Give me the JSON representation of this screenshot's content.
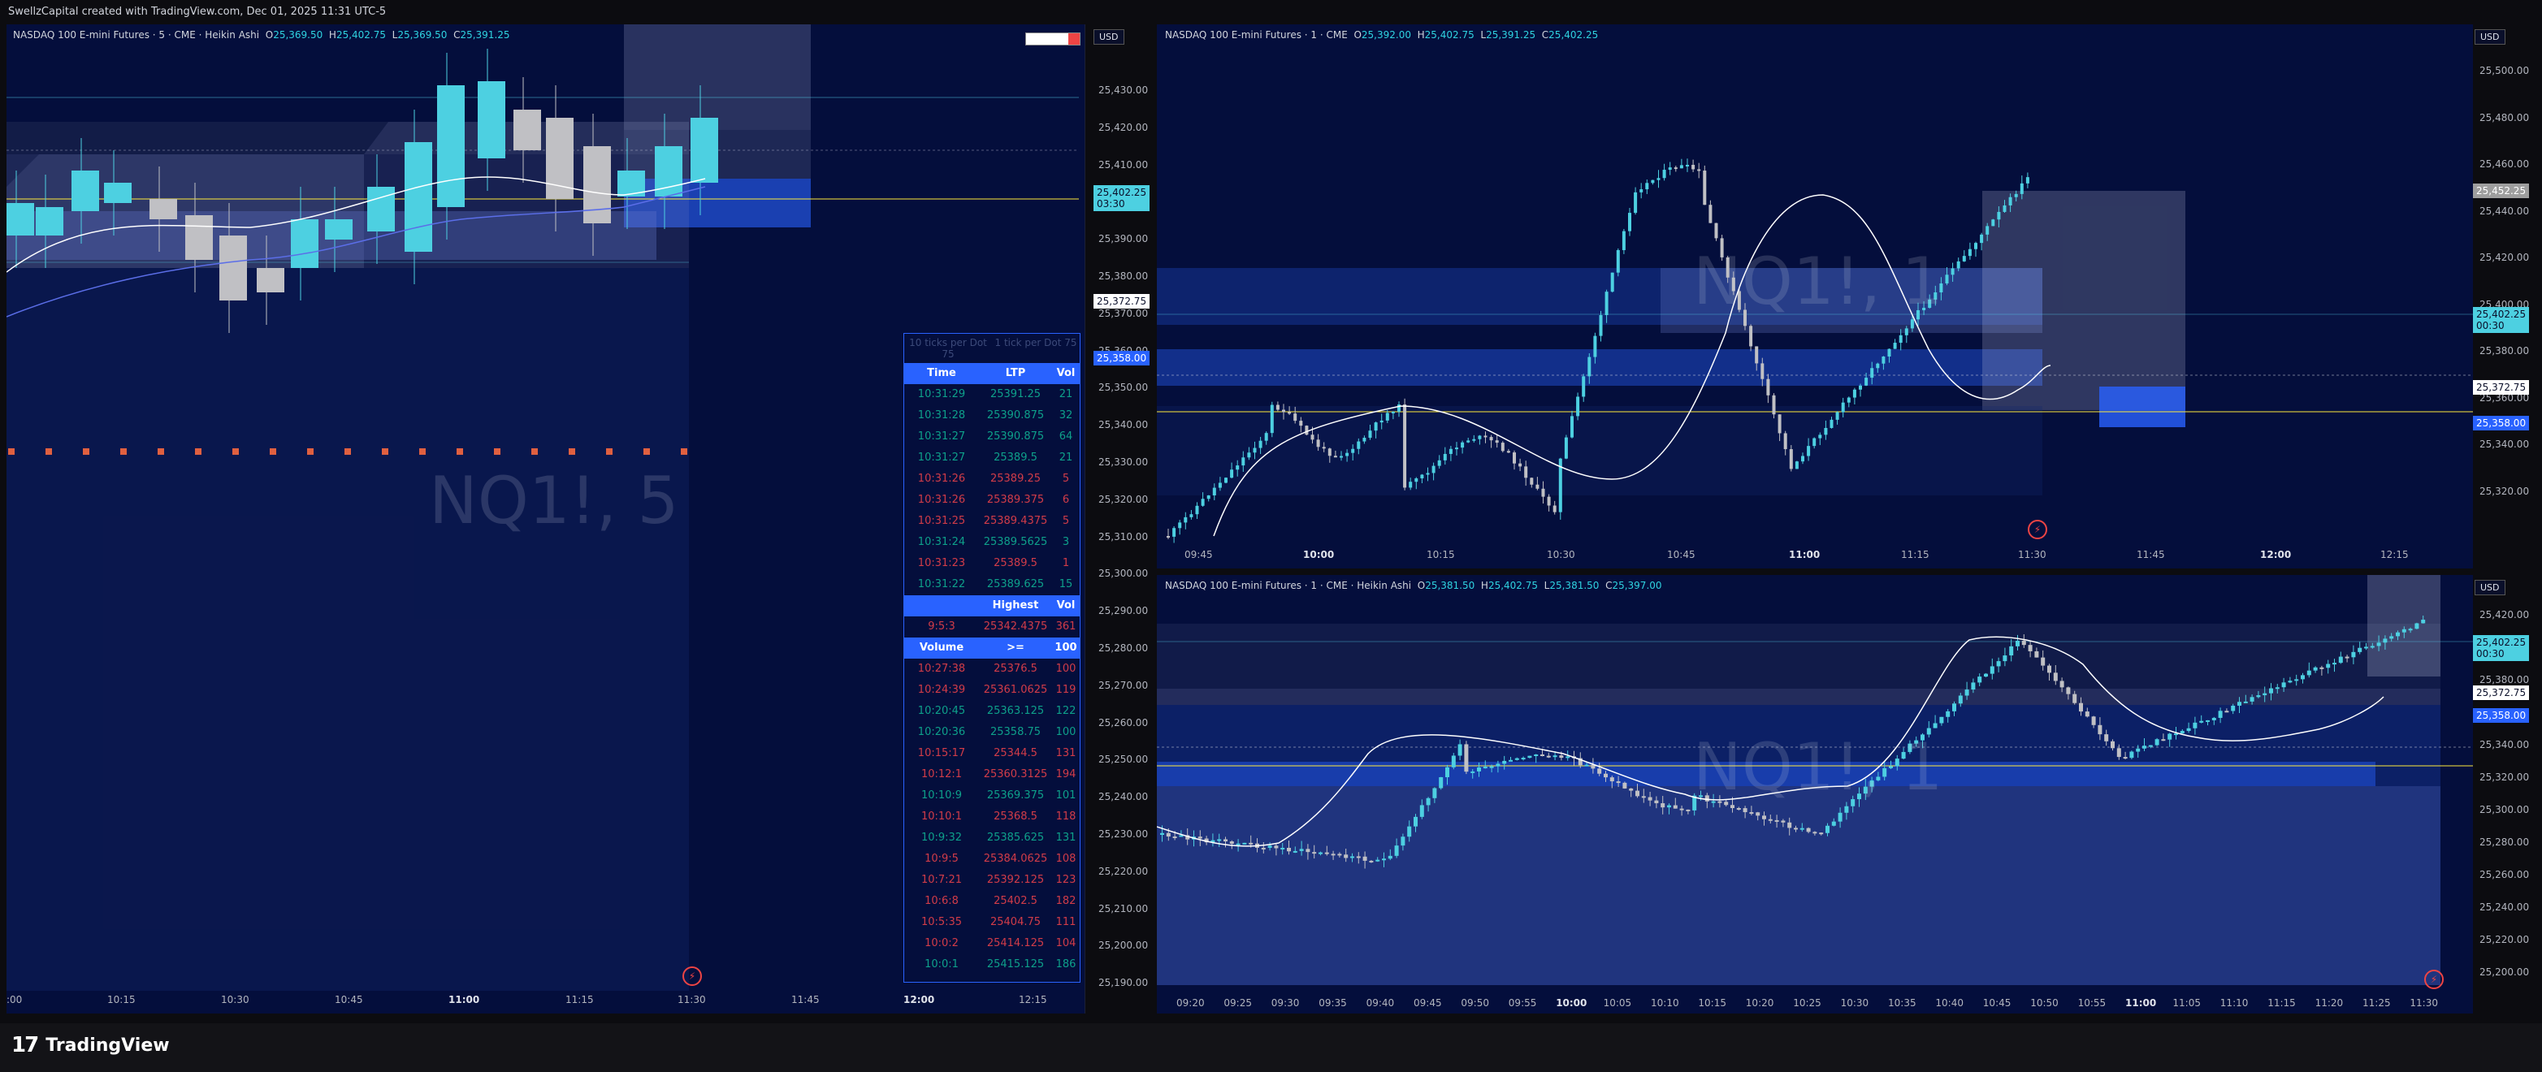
{
  "title_bar": "SwellzCapital created with TradingView.com, Dec 01, 2025 11:31 UTC-5",
  "brand": {
    "mark": "17",
    "name": "TradingView"
  },
  "left_pane": {
    "legend": {
      "name": "NASDAQ 100 E-mini Futures · 5 · CME · Heikin Ashi",
      "o_label": "O",
      "o": "25,369.50",
      "h_label": "H",
      "h": "25,402.75",
      "l_label": "L",
      "l": "25,369.50",
      "c_label": "C",
      "c": "25,391.25"
    },
    "watermark": "NQ1!, 5",
    "currency": "USD",
    "y_ticks": [
      "25,430.00",
      "25,420.00",
      "25,410.00",
      "25,400.00",
      "25,390.00",
      "25,380.00",
      "25,370.00",
      "25,360.00",
      "25,350.00",
      "25,340.00",
      "25,330.00",
      "25,320.00",
      "25,310.00",
      "25,300.00",
      "25,290.00",
      "25,280.00",
      "25,270.00",
      "25,260.00",
      "25,250.00",
      "25,240.00",
      "25,230.00",
      "25,220.00",
      "25,210.00",
      "25,200.00",
      "25,190.00"
    ],
    "price_tags": [
      {
        "text": "25,402.25",
        "sub": "03:30"
      },
      {
        "text": "25,372.75"
      },
      {
        "text": "25,358.00"
      }
    ],
    "x_ticks": [
      {
        "label": ":00",
        "bold": false
      },
      {
        "label": "10:15",
        "bold": false
      },
      {
        "label": "10:30",
        "bold": false
      },
      {
        "label": "10:45",
        "bold": false
      },
      {
        "label": "11:00",
        "bold": true
      },
      {
        "label": "11:15",
        "bold": false
      },
      {
        "label": "11:30",
        "bold": false
      },
      {
        "label": "11:45",
        "bold": false
      },
      {
        "label": "12:00",
        "bold": true
      },
      {
        "label": "12:15",
        "bold": false
      }
    ]
  },
  "tape": {
    "group_headers": [
      "10 ticks per Dot 75",
      "1 tick per Dot 75"
    ],
    "trades_header": [
      "Time",
      "LTP",
      "Vol"
    ],
    "trades": [
      {
        "time": "10:31:29",
        "ltp": "25391.25",
        "vol": "21",
        "side": "g"
      },
      {
        "time": "10:31:28",
        "ltp": "25390.875",
        "vol": "32",
        "side": "g"
      },
      {
        "time": "10:31:27",
        "ltp": "25390.875",
        "vol": "64",
        "side": "g"
      },
      {
        "time": "10:31:27",
        "ltp": "25389.5",
        "vol": "21",
        "side": "g"
      },
      {
        "time": "10:31:26",
        "ltp": "25389.25",
        "vol": "5",
        "side": "r"
      },
      {
        "time": "10:31:26",
        "ltp": "25389.375",
        "vol": "6",
        "side": "r"
      },
      {
        "time": "10:31:25",
        "ltp": "25389.4375",
        "vol": "5",
        "side": "r"
      },
      {
        "time": "10:31:24",
        "ltp": "25389.5625",
        "vol": "3",
        "side": "g"
      },
      {
        "time": "10:31:23",
        "ltp": "25389.5",
        "vol": "1",
        "side": "r"
      },
      {
        "time": "10:31:22",
        "ltp": "25389.625",
        "vol": "15",
        "side": "g"
      }
    ],
    "highest_header": [
      "",
      "Highest",
      "Vol"
    ],
    "highest_row": {
      "time": "9:5:3",
      "ltp": "25342.4375",
      "vol": "361",
      "side": "r"
    },
    "volume_header": [
      "Volume",
      ">=",
      "100"
    ],
    "big_trades": [
      {
        "time": "10:27:38",
        "ltp": "25376.5",
        "vol": "100",
        "side": "r"
      },
      {
        "time": "10:24:39",
        "ltp": "25361.0625",
        "vol": "119",
        "side": "r"
      },
      {
        "time": "10:20:45",
        "ltp": "25363.125",
        "vol": "122",
        "side": "g"
      },
      {
        "time": "10:20:36",
        "ltp": "25358.75",
        "vol": "100",
        "side": "g"
      },
      {
        "time": "10:15:17",
        "ltp": "25344.5",
        "vol": "131",
        "side": "r"
      },
      {
        "time": "10:12:1",
        "ltp": "25360.3125",
        "vol": "194",
        "side": "r"
      },
      {
        "time": "10:10:9",
        "ltp": "25369.375",
        "vol": "101",
        "side": "g"
      },
      {
        "time": "10:10:1",
        "ltp": "25368.5",
        "vol": "118",
        "side": "r"
      },
      {
        "time": "10:9:32",
        "ltp": "25385.625",
        "vol": "131",
        "side": "g"
      },
      {
        "time": "10:9:5",
        "ltp": "25384.0625",
        "vol": "108",
        "side": "r"
      },
      {
        "time": "10:7:21",
        "ltp": "25392.125",
        "vol": "123",
        "side": "r"
      },
      {
        "time": "10:6:8",
        "ltp": "25402.5",
        "vol": "182",
        "side": "r"
      },
      {
        "time": "10:5:35",
        "ltp": "25404.75",
        "vol": "111",
        "side": "r"
      },
      {
        "time": "10:0:2",
        "ltp": "25414.125",
        "vol": "104",
        "side": "r"
      },
      {
        "time": "10:0:1",
        "ltp": "25415.125",
        "vol": "186",
        "side": "g"
      }
    ]
  },
  "top_right_pane": {
    "legend": {
      "name": "NASDAQ 100 E-mini Futures · 1 · CME",
      "o_label": "O",
      "o": "25,392.00",
      "h_label": "H",
      "h": "25,402.75",
      "l_label": "L",
      "l": "25,391.25",
      "c_label": "C",
      "c": "25,402.25"
    },
    "watermark": "NQ1!, 1",
    "currency": "USD",
    "y_ticks": [
      "25,500.00",
      "25,480.00",
      "25,460.00",
      "25,440.00",
      "25,420.00",
      "25,400.00",
      "25,380.00",
      "25,360.00",
      "25,340.00",
      "25,320.00"
    ],
    "price_tags": [
      {
        "text": "25,452.25"
      },
      {
        "text": "25,402.25",
        "sub": "00:30"
      },
      {
        "text": "25,372.75"
      },
      {
        "text": "25,358.00"
      }
    ],
    "x_ticks": [
      {
        "label": "09:45",
        "bold": false
      },
      {
        "label": "10:00",
        "bold": true
      },
      {
        "label": "10:15",
        "bold": false
      },
      {
        "label": "10:30",
        "bold": false
      },
      {
        "label": "10:45",
        "bold": false
      },
      {
        "label": "11:00",
        "bold": true
      },
      {
        "label": "11:15",
        "bold": false
      },
      {
        "label": "11:30",
        "bold": false
      },
      {
        "label": "11:45",
        "bold": false
      },
      {
        "label": "12:00",
        "bold": true
      },
      {
        "label": "12:15",
        "bold": false
      }
    ]
  },
  "bottom_right_pane": {
    "legend": {
      "name": "NASDAQ 100 E-mini Futures · 1 · CME · Heikin Ashi",
      "o_label": "O",
      "o": "25,381.50",
      "h_label": "H",
      "h": "25,402.75",
      "l_label": "L",
      "l": "25,381.50",
      "c_label": "C",
      "c": "25,397.00"
    },
    "watermark": "NQ1!, 1",
    "currency": "USD",
    "y_ticks": [
      "25,420.00",
      "25,400.00",
      "25,380.00",
      "25,360.00",
      "25,340.00",
      "25,320.00",
      "25,300.00",
      "25,280.00",
      "25,260.00",
      "25,240.00",
      "25,220.00",
      "25,200.00"
    ],
    "price_tags": [
      {
        "text": "25,402.25",
        "sub": "00:30"
      },
      {
        "text": "25,372.75"
      },
      {
        "text": "25,358.00"
      }
    ],
    "x_ticks": [
      {
        "label": "09:20",
        "bold": false
      },
      {
        "label": "09:25",
        "bold": false
      },
      {
        "label": "09:30",
        "bold": false
      },
      {
        "label": "09:35",
        "bold": false
      },
      {
        "label": "09:40",
        "bold": false
      },
      {
        "label": "09:45",
        "bold": false
      },
      {
        "label": "09:50",
        "bold": false
      },
      {
        "label": "09:55",
        "bold": false
      },
      {
        "label": "10:00",
        "bold": true
      },
      {
        "label": "10:05",
        "bold": false
      },
      {
        "label": "10:10",
        "bold": false
      },
      {
        "label": "10:15",
        "bold": false
      },
      {
        "label": "10:20",
        "bold": false
      },
      {
        "label": "10:25",
        "bold": false
      },
      {
        "label": "10:30",
        "bold": false
      },
      {
        "label": "10:35",
        "bold": false
      },
      {
        "label": "10:40",
        "bold": false
      },
      {
        "label": "10:45",
        "bold": false
      },
      {
        "label": "10:50",
        "bold": false
      },
      {
        "label": "10:55",
        "bold": false
      },
      {
        "label": "11:00",
        "bold": true
      },
      {
        "label": "11:05",
        "bold": false
      },
      {
        "label": "11:10",
        "bold": false
      },
      {
        "label": "11:15",
        "bold": false
      },
      {
        "label": "11:20",
        "bold": false
      },
      {
        "label": "11:25",
        "bold": false
      },
      {
        "label": "11:30",
        "bold": false
      }
    ]
  },
  "colors": {
    "bull": "#4dd0e1",
    "bear": "#c0c0c4",
    "bg": "#040e3c",
    "accent": "#2962ff",
    "level": "#ffeb3b"
  },
  "icons": {
    "replay": "lightning-icon",
    "flag": "flag-icon"
  }
}
